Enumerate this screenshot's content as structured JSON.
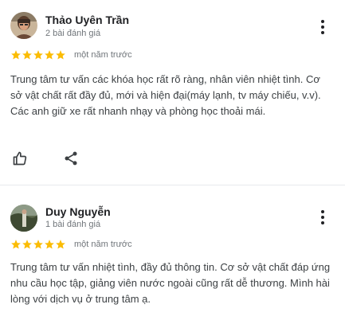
{
  "reviews": [
    {
      "author": "Thảo Uyên Trần",
      "review_count": "2 bài đánh giá",
      "rating": 5,
      "time": "một năm trước",
      "text": "Trung tâm tư vấn các khóa học rất rõ ràng, nhân viên nhiệt tình. Cơ sở vật chất rất đầy đủ, mới và hiện đại(máy lạnh, tv máy chiếu, v.v). Các anh giữ xe rất nhanh nhạy và phòng học thoải mái.",
      "icons": [
        "avatar-photo",
        "more-vert-icon",
        "thumb-up-icon",
        "share-icon"
      ]
    },
    {
      "author": "Duy Nguyễn",
      "review_count": "1 bài đánh giá",
      "rating": 5,
      "time": "một năm trước",
      "text": "Trung tâm tư vấn nhiệt tình, đầy đủ thông tin. Cơ sở vật chất đáp ứng nhu cầu học tập, giảng viên nước ngoài cũng rất dễ thương. Mình hài lòng với dịch vụ ở trung tâm ạ.",
      "icons": [
        "avatar-photo",
        "more-vert-icon"
      ]
    }
  ],
  "colors": {
    "star": "#fbbc04",
    "secondary_text": "#70757a",
    "body_text": "#3c4043",
    "icon": "#5f6368",
    "divider": "#e8eaed"
  }
}
